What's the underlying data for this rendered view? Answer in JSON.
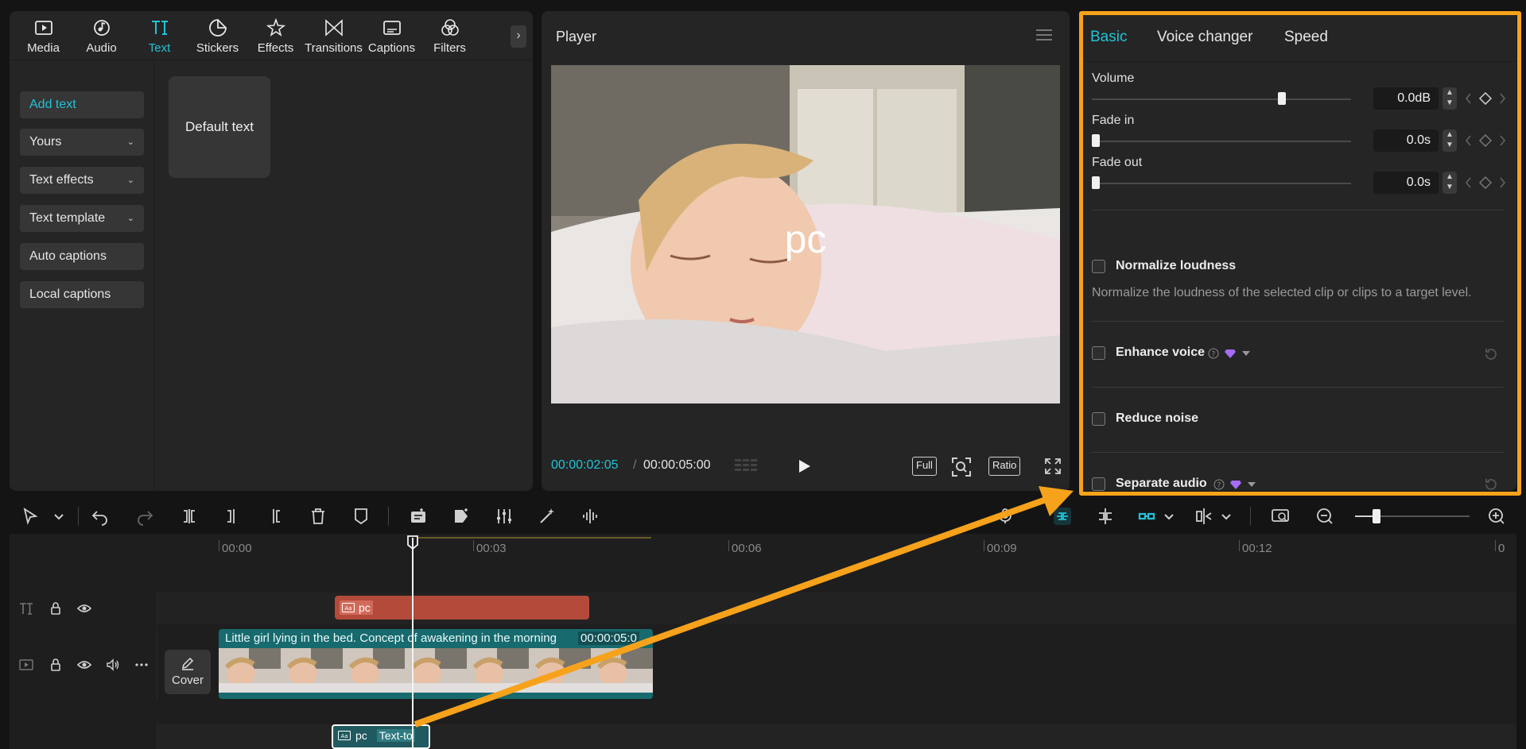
{
  "tabs": [
    {
      "label": "Media",
      "icon": "media-icon"
    },
    {
      "label": "Audio",
      "icon": "audio-icon"
    },
    {
      "label": "Text",
      "icon": "text-icon"
    },
    {
      "label": "Stickers",
      "icon": "stickers-icon"
    },
    {
      "label": "Effects",
      "icon": "effects-icon"
    },
    {
      "label": "Transitions",
      "icon": "transitions-icon"
    },
    {
      "label": "Captions",
      "icon": "captions-icon"
    },
    {
      "label": "Filters",
      "icon": "filters-icon"
    }
  ],
  "sidebar": {
    "add_text": "Add text",
    "yours": "Yours",
    "text_effects": "Text effects",
    "text_template": "Text template",
    "auto_captions": "Auto captions",
    "local_captions": "Local captions"
  },
  "text_card": "Default text",
  "player": {
    "title": "Player",
    "overlay_text": "pc",
    "current_time": "00:00:02:05",
    "separator": "/",
    "total_time": "00:00:05:00",
    "full_label": "Full",
    "ratio_label": "Ratio"
  },
  "inspector": {
    "tabs": {
      "basic": "Basic",
      "voice_changer": "Voice changer",
      "speed": "Speed"
    },
    "volume": {
      "label": "Volume",
      "value": "0.0dB",
      "level": 0.74
    },
    "fade_in": {
      "label": "Fade in",
      "value": "0.0s",
      "level": 0
    },
    "fade_out": {
      "label": "Fade out",
      "value": "0.0s",
      "level": 0
    },
    "normalize": {
      "label": "Normalize loudness",
      "desc": "Normalize the loudness of the selected clip or clips to a target level."
    },
    "enhance_voice": "Enhance voice",
    "reduce_noise": "Reduce noise",
    "separate_audio": "Separate audio"
  },
  "timeline": {
    "ruler": [
      "00:00",
      "00:03",
      "00:06",
      "00:09",
      "00:12",
      "0"
    ],
    "text_clip": "pc",
    "video_clip_title": "Little girl lying in the bed. Concept of awakening in the morning",
    "video_clip_duration": "00:00:05:0",
    "cover_label": "Cover",
    "audio_clip_name": "pc",
    "audio_clip_sub": "Text-to"
  },
  "colors": {
    "accent": "#22c3d8",
    "highlight": "#f7a21b",
    "text_clip": "#b34a3a",
    "video_clip": "#176a6e"
  }
}
